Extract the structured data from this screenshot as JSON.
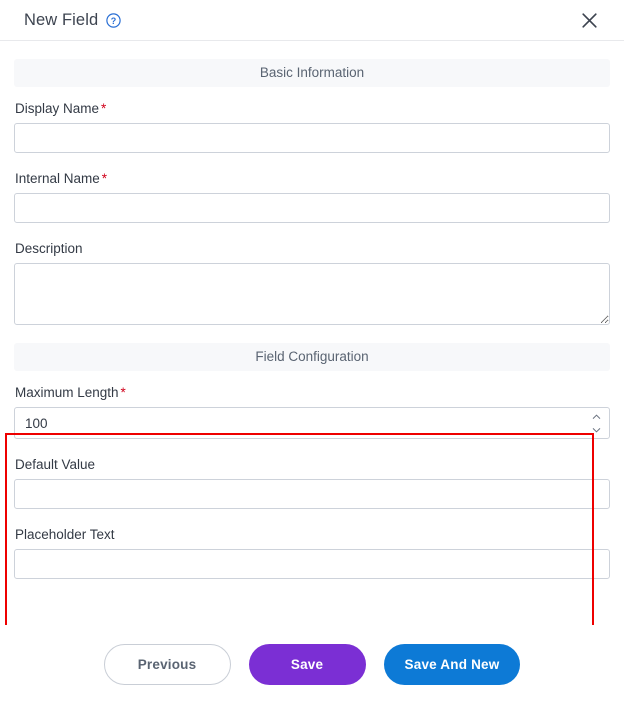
{
  "header": {
    "title": "New Field",
    "help_icon": "help-circle-icon",
    "close_icon": "close-icon"
  },
  "sections": [
    {
      "title": "Basic Information"
    },
    {
      "title": "Field Configuration"
    }
  ],
  "basic_information": {
    "display_name": {
      "label": "Display Name",
      "required_marker": "*",
      "value": "",
      "placeholder": ""
    },
    "internal_name": {
      "label": "Internal Name",
      "required_marker": "*",
      "value": "",
      "placeholder": ""
    },
    "description": {
      "label": "Description",
      "value": "",
      "placeholder": ""
    }
  },
  "field_configuration": {
    "maximum_length": {
      "label": "Maximum Length",
      "required_marker": "*",
      "value": "100",
      "placeholder": "",
      "spinner_up_icon": "chevron-up-icon",
      "spinner_down_icon": "chevron-down-icon"
    },
    "default_value": {
      "label": "Default Value",
      "value": "",
      "placeholder": ""
    },
    "placeholder_text": {
      "label": "Placeholder Text",
      "value": "",
      "placeholder": ""
    }
  },
  "footer": {
    "previous_label": "Previous",
    "save_label": "Save",
    "save_and_new_label": "Save And New"
  },
  "colors": {
    "save_purple": "#7b2fd4",
    "save_new_blue": "#0d7ad6",
    "highlight_red": "#ee0000",
    "required_red": "#d0021b",
    "section_bar_bg": "#f7f8fa",
    "input_border": "#cdd2da",
    "help_blue": "#2a6fd4"
  }
}
